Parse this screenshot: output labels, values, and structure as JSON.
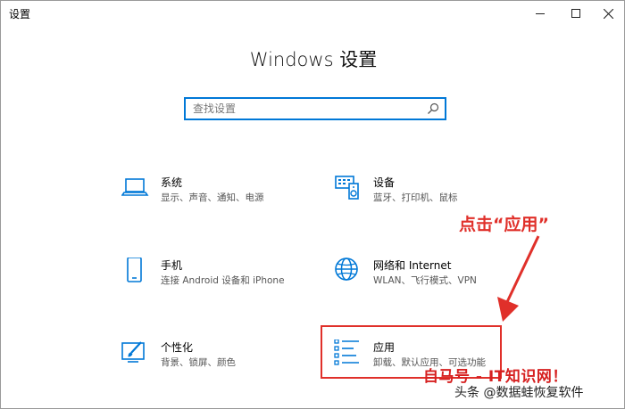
{
  "window": {
    "title": "设置"
  },
  "header": {
    "title": "Windows 设置"
  },
  "search": {
    "placeholder": "查找设置"
  },
  "tiles": [
    {
      "name": "系统",
      "desc": "显示、声音、通知、电源",
      "icon": "laptop-icon"
    },
    {
      "name": "设备",
      "desc": "蓝牙、打印机、鼠标",
      "icon": "devices-icon"
    },
    {
      "name": "手机",
      "desc": "连接 Android 设备和 iPhone",
      "icon": "phone-icon"
    },
    {
      "name": "网络和 Internet",
      "desc": "WLAN、飞行模式、VPN",
      "icon": "globe-icon"
    },
    {
      "name": "个性化",
      "desc": "背景、锁屏、颜色",
      "icon": "personalization-icon"
    },
    {
      "name": "应用",
      "desc": "卸载、默认应用、可选功能",
      "icon": "apps-list-icon"
    }
  ],
  "annotation": {
    "text": "点击“应用”",
    "color": "#e0302a"
  },
  "watermark": {
    "text": "自马号 - IT知识网！",
    "text2": "头条 @数据蛙恢复软件"
  },
  "colors": {
    "accent": "#0078d7",
    "highlight": "#e0302a"
  }
}
